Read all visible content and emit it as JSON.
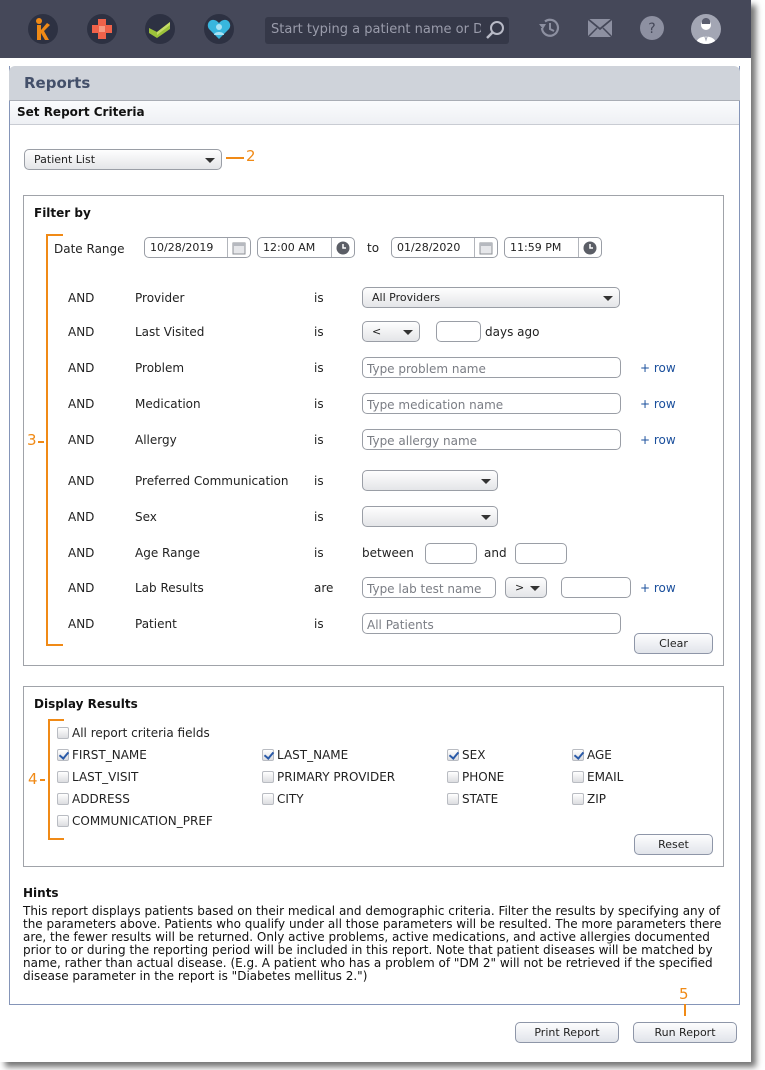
{
  "topbar": {
    "apps": [
      {
        "name": "kareo-logo",
        "color": "#f08a16"
      },
      {
        "name": "clinical-app",
        "color": "#f0624a"
      },
      {
        "name": "billing-app",
        "color": "#9cc23a"
      },
      {
        "name": "engage-app",
        "color": "#38b6de"
      }
    ],
    "search_placeholder": "Start typing a patient name or DOB",
    "icons": [
      "history-icon",
      "mail-icon",
      "help-icon",
      "user-avatar"
    ]
  },
  "page": {
    "title": "Reports",
    "section_title": "Set Report Criteria",
    "report_type": "Patient List"
  },
  "annotations": {
    "report_type": "2",
    "filters": "3",
    "display": "4",
    "run": "5"
  },
  "filter": {
    "title": "Filter by",
    "date_range": {
      "label": "Date Range",
      "from_date": "10/28/2019",
      "from_time": "12:00 AM",
      "to_label": "to",
      "to_date": "01/28/2020",
      "to_time": "11:59 PM"
    },
    "connector": "AND",
    "rows": {
      "provider": {
        "field": "Provider",
        "op": "is",
        "value": "All Providers"
      },
      "last_visited": {
        "field": "Last Visited",
        "op": "is",
        "comparator": "<",
        "days_value": "",
        "suffix": "days ago"
      },
      "problem": {
        "field": "Problem",
        "op": "is",
        "placeholder": "Type problem name",
        "add": "+ row"
      },
      "medication": {
        "field": "Medication",
        "op": "is",
        "placeholder": "Type medication name",
        "add": "+ row"
      },
      "allergy": {
        "field": "Allergy",
        "op": "is",
        "placeholder": "Type allergy name",
        "add": "+ row"
      },
      "communication": {
        "field": "Preferred Communication",
        "op": "is",
        "value": ""
      },
      "sex": {
        "field": "Sex",
        "op": "is",
        "value": ""
      },
      "age_range": {
        "field": "Age Range",
        "op": "is",
        "between": "between",
        "and": "and",
        "min": "",
        "max": ""
      },
      "lab_results": {
        "field": "Lab Results",
        "op": "are",
        "placeholder": "Type lab test name",
        "comparator": ">",
        "value": "",
        "add": "+ row"
      },
      "patient": {
        "field": "Patient",
        "op": "is",
        "placeholder": "All Patients"
      }
    },
    "clear_label": "Clear"
  },
  "display": {
    "title": "Display Results",
    "all_fields": {
      "label": "All report criteria fields",
      "checked": false
    },
    "fields": [
      {
        "label": "FIRST_NAME",
        "checked": true
      },
      {
        "label": "LAST_NAME",
        "checked": true
      },
      {
        "label": "SEX",
        "checked": true
      },
      {
        "label": "AGE",
        "checked": true
      },
      {
        "label": "LAST_VISIT",
        "checked": false
      },
      {
        "label": "PRIMARY PROVIDER",
        "checked": false
      },
      {
        "label": "PHONE",
        "checked": false
      },
      {
        "label": "EMAIL",
        "checked": false
      },
      {
        "label": "ADDRESS",
        "checked": false
      },
      {
        "label": "CITY",
        "checked": false
      },
      {
        "label": "STATE",
        "checked": false
      },
      {
        "label": "ZIP",
        "checked": false
      },
      {
        "label": "COMMUNICATION_PREF",
        "checked": false
      }
    ],
    "reset_label": "Reset"
  },
  "hints": {
    "title": "Hints",
    "text": "This report displays patients based on their medical and demographic criteria. Filter the results by specifying any of the parameters above. Patients who qualify under all those parameters will be resulted. The more parameters there are, the fewer results will be returned. Only active problems, active medications, and active allergies documented prior to or during the reporting period will be included in this report. Note that patient diseases will be matched by name, rather than actual disease. (E.g. A patient who has a problem of \"DM 2\" will not be retrieved if the specified disease parameter in the report is \"Diabetes mellitus 2.\")"
  },
  "footer": {
    "print_label": "Print Report",
    "run_label": "Run Report"
  }
}
